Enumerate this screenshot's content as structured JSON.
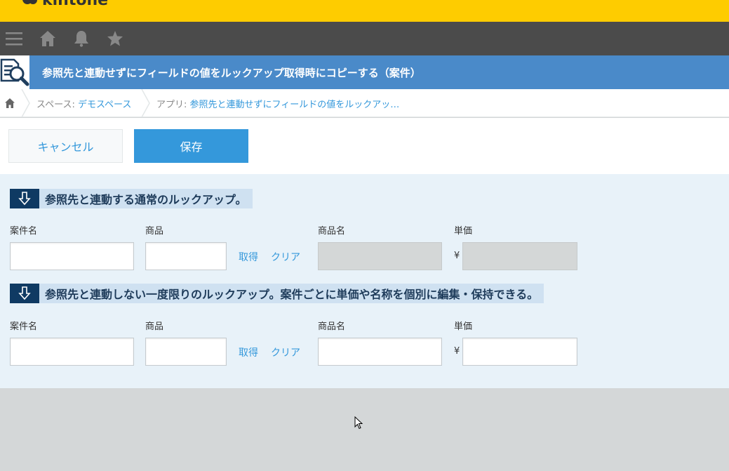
{
  "topbar": {
    "logo_text": "kintone",
    "color": "#fecc00"
  },
  "nav": {
    "icons": [
      "menu-icon",
      "home-icon",
      "bell-icon",
      "star-icon"
    ]
  },
  "app": {
    "title": "参照先と連動せずにフィールドの値をルックアップ取得時にコピーする（案件）",
    "icon": "app-document-search-icon"
  },
  "breadcrumb": {
    "space_prefix": "スペース: ",
    "space_name": "デモスペース",
    "app_prefix": "アプリ: ",
    "app_name": "参照先と連動せずにフィールドの値をルックアッ…"
  },
  "toolbar": {
    "cancel_label": "キャンセル",
    "save_label": "保存"
  },
  "sections": [
    {
      "label": "参照先と連動する通常のルックアップ。",
      "fields": {
        "case_name": {
          "label": "案件名",
          "value": ""
        },
        "product": {
          "label": "商品",
          "value": ""
        },
        "get_label": "取得",
        "clear_label": "クリア",
        "product_name": {
          "label": "商品名",
          "value": "",
          "disabled": true
        },
        "unit_price": {
          "label": "単価",
          "currency": "¥",
          "value": "",
          "disabled": true
        }
      }
    },
    {
      "label": "参照先と連動しない一度限りのルックアップ。案件ごとに単価や名称を個別に編集・保持できる。",
      "fields": {
        "case_name": {
          "label": "案件名",
          "value": ""
        },
        "product": {
          "label": "商品",
          "value": ""
        },
        "get_label": "取得",
        "clear_label": "クリア",
        "product_name": {
          "label": "商品名",
          "value": "",
          "disabled": false
        },
        "unit_price": {
          "label": "単価",
          "currency": "¥",
          "value": "",
          "disabled": false
        }
      }
    }
  ],
  "colors": {
    "accent": "#3498db",
    "header": "#4a8ac9",
    "section_dark": "#0f3a63"
  }
}
